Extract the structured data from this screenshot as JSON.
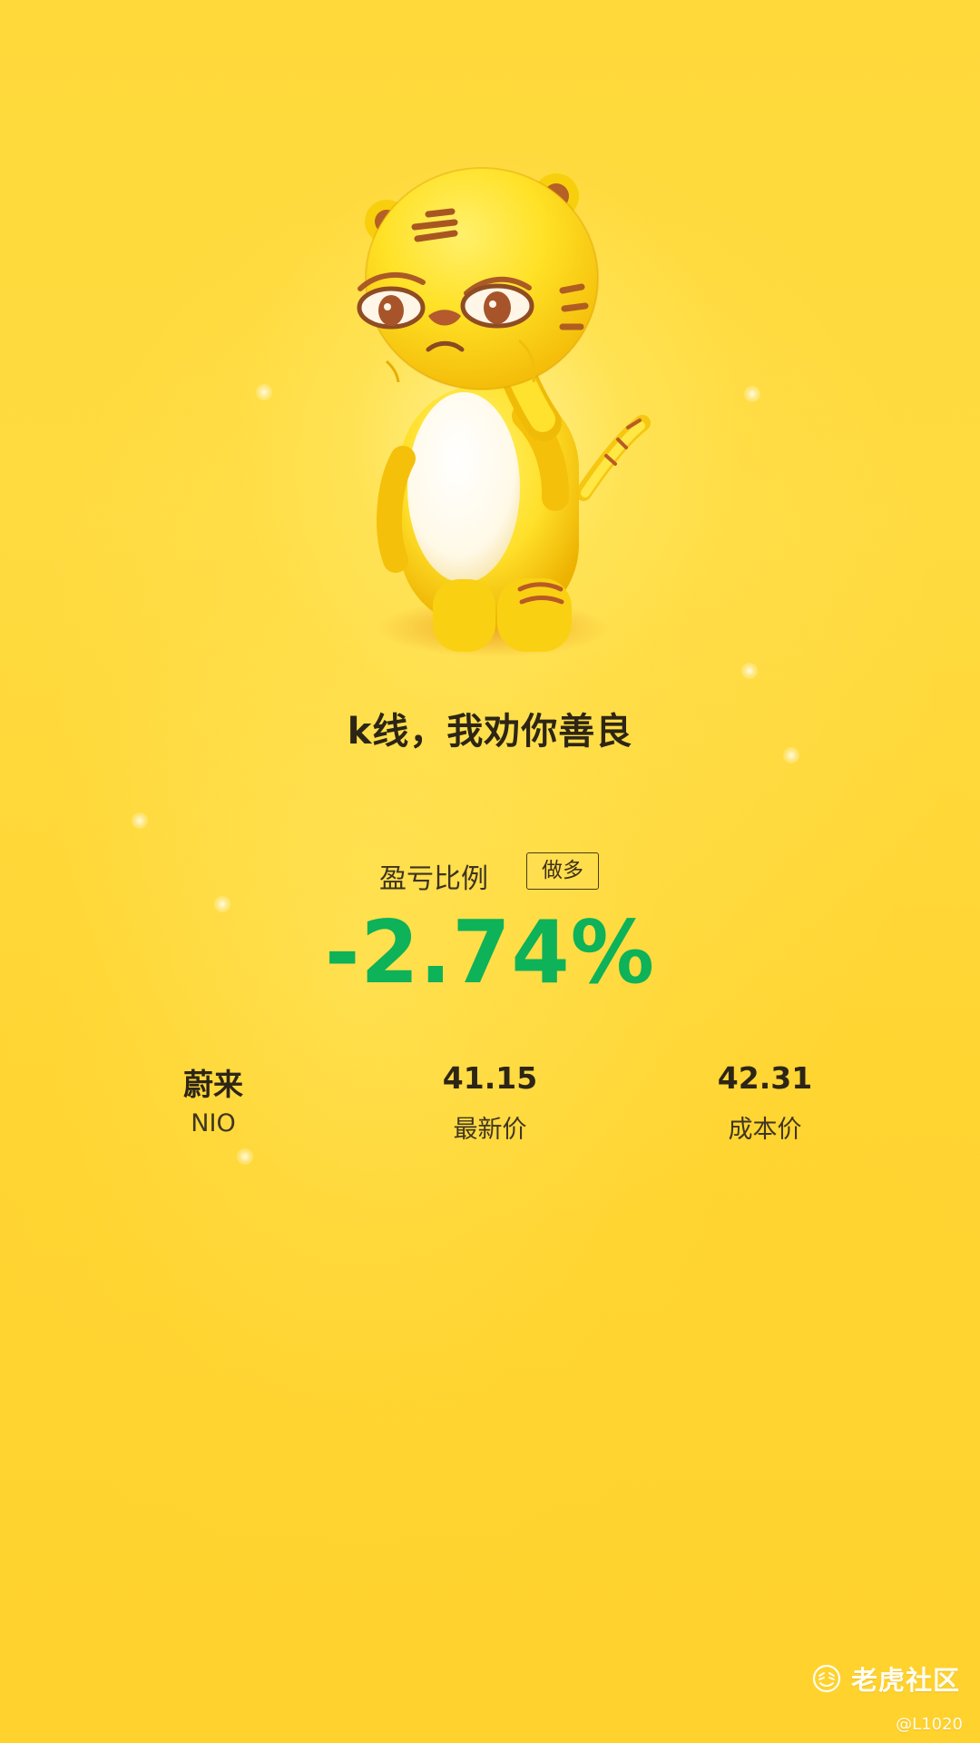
{
  "poster": {
    "headline": "k线，我劝你善良",
    "profit_label": "盈亏比例",
    "direction": "做多",
    "profit_value": "-2.74%",
    "profit_color": "#0DB259"
  },
  "stock": {
    "name": "蔚来",
    "symbol": "NIO",
    "latest_price": "41.15",
    "latest_price_label": "最新价",
    "cost_price": "42.31",
    "cost_price_label": "成本价"
  },
  "branding": {
    "community": "老虎社区",
    "user": "@L1020"
  },
  "icons": {
    "mascot": "tiger-mascot-icon",
    "logo": "tiger-logo-icon"
  },
  "colors": {
    "background": "#FFD93A",
    "text": "#2d2515",
    "accent": "#0DB259"
  }
}
